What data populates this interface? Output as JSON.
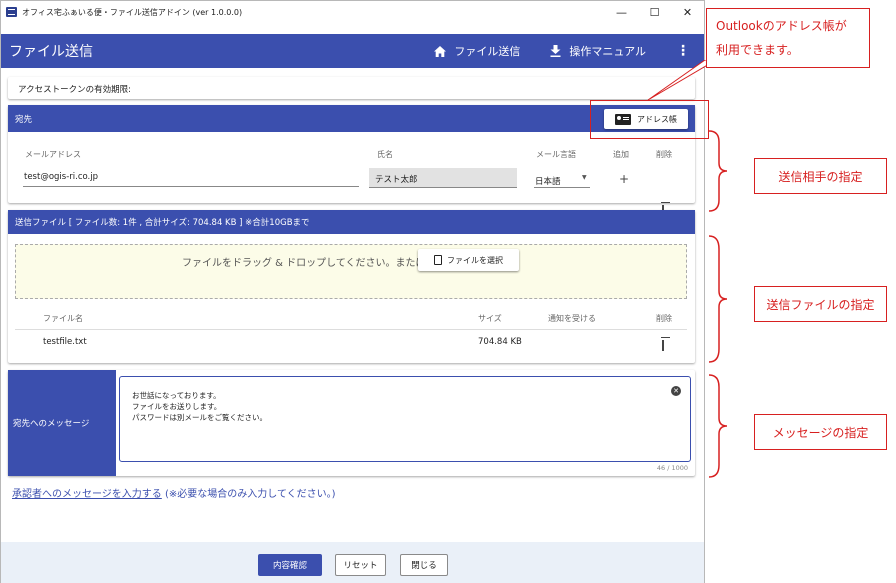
{
  "window": {
    "title": "オフィス宅ふぁいる便・ファイル送信アドイン (ver 1.0.0.0)",
    "min": "—",
    "max": "☐",
    "close": "✕"
  },
  "appbar": {
    "title": "ファイル送信",
    "nav_send": "ファイル送信",
    "nav_manual": "操作マニュアル",
    "more": "⋮"
  },
  "token": {
    "label": "アクセストークンの有効期限:"
  },
  "recipient": {
    "header": "宛先",
    "address_book_button": "アドレス帳",
    "columns": {
      "email": "メールアドレス",
      "name": "氏名",
      "lang": "メール言語",
      "add": "追加",
      "delete": "削除"
    },
    "row": {
      "email": "test@ogis-ri.co.jp",
      "name": "テスト太郎",
      "lang": "日本語",
      "add": "+"
    }
  },
  "files": {
    "header": "送信ファイル [ ファイル数: 1件 , 合計サイズ: 704.84 KB ] ※合計10GBまで",
    "drop_text": "ファイルをドラッグ & ドロップしてください。または、",
    "select_button": "ファイルを選択",
    "columns": {
      "name": "ファイル名",
      "size": "サイズ",
      "notify": "通知を受ける",
      "delete": "削除"
    },
    "rows": [
      {
        "name": "testfile.txt",
        "size": "704.84 KB",
        "notify": true
      }
    ]
  },
  "message": {
    "label": "宛先へのメッセージ",
    "lines": [
      "お世話になっております。",
      "ファイルをお送りします。",
      "パスワードは別メールをご覧ください。"
    ],
    "count": "46 / 1000"
  },
  "approver": {
    "link": "承認者へのメッセージを入力する",
    "note": "(※必要な場合のみ入力してください。)"
  },
  "footer": {
    "confirm": "内容確認",
    "reset": "リセット",
    "close": "閉じる"
  },
  "annotations": {
    "outlook": [
      "Outlookのアドレス帳が",
      "利用できます。"
    ],
    "recipient": "送信相手の指定",
    "files": "送信ファイルの指定",
    "message": "メッセージの指定"
  },
  "colors": {
    "primary": "#3b4fae",
    "annotation": "#d72020",
    "drop_bg": "#fcfce8",
    "footer_bg": "#eaf0f8"
  }
}
